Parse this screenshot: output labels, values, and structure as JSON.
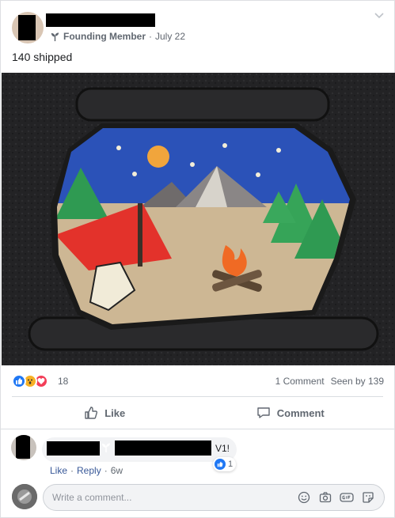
{
  "post": {
    "badge": "Founding Member",
    "separator": "·",
    "date": "July 22",
    "text": "140 shipped"
  },
  "reactions": {
    "types": [
      "like-icon",
      "wow-icon",
      "love-icon"
    ],
    "count": "18",
    "comments": "1 Comment",
    "seen": "Seen by 139"
  },
  "actions": {
    "like": "Like",
    "comment": "Comment"
  },
  "comment": {
    "text": "V1!",
    "reaction_count": "1",
    "like": "Like",
    "reply": "Reply",
    "dot": "·",
    "time": "6w"
  },
  "composer": {
    "placeholder": "Write a comment..."
  },
  "colors": {
    "like_blue": "#2078f4",
    "link": "#385898",
    "muted": "#606770"
  }
}
